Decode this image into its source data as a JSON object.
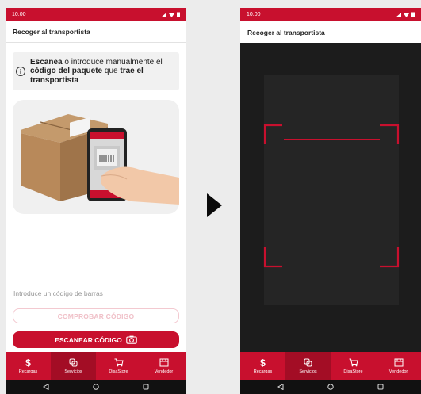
{
  "screen1": {
    "status_time": "10:00",
    "title": "Recoger al transportista",
    "info": {
      "part1": "Escanea",
      "part2": " o introduce manualmente el ",
      "part3": "código del paquete",
      "part4": " que ",
      "part5": "trae el transportista"
    },
    "barcode_placeholder": "Introduce un código de barras",
    "check_button": "COMPROBAR CÓDIGO",
    "scan_button": "ESCANEAR CÓDIGO"
  },
  "screen2": {
    "status_time": "10:00",
    "title": "Recoger al transportista"
  },
  "nav": {
    "items": [
      {
        "label": "Recargas",
        "icon": "dollar-icon"
      },
      {
        "label": "Servicios",
        "icon": "services-icon"
      },
      {
        "label": "DisaStore",
        "icon": "cart-icon"
      },
      {
        "label": "Vendedor",
        "icon": "store-icon"
      }
    ],
    "active_index": 1
  },
  "colors": {
    "brand": "#c8102e",
    "brand_dark": "#a30d25",
    "camera_bg": "#1c1c1c"
  }
}
